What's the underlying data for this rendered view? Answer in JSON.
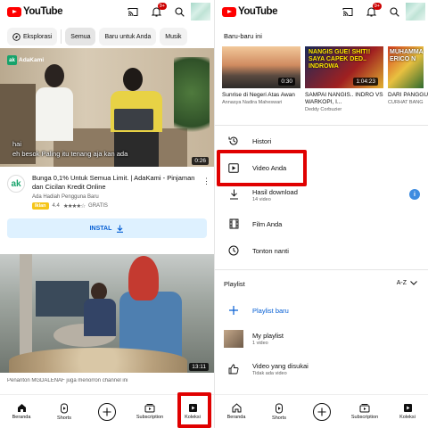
{
  "left": {
    "logo_text": "YouTube",
    "notif_count": "9+",
    "chips": [
      "Eksplorasi",
      "Semua",
      "Baru untuk Anda",
      "Musik"
    ],
    "video1": {
      "brand": "AdaKami",
      "caption_line1": "hai",
      "caption_line2": "eh besok Paling itu tenang aja kan ada",
      "duration": "0:26",
      "title": "Bunga 0,1% Untuk Semua Limit. | AdaKami - Pinjaman dan Cicilan Kredit Online",
      "sub": "Ada Hadiah Pengguna Baru",
      "ad_label": "Iklan",
      "rating": "4.4",
      "stars": "★★★★☆",
      "price": "GRATIS",
      "install_label": "INSTAL"
    },
    "video2": {
      "duration": "13:11",
      "meta": "Penanton MGDALENAF juga menorron channel ini"
    },
    "nav": [
      "Beranda",
      "Shorts",
      "",
      "Subscription",
      "Koleksi"
    ]
  },
  "right": {
    "logo_text": "YouTube",
    "notif_count": "9+",
    "recent_title": "Baru-baru ini",
    "recent": [
      {
        "title": "Sunrise di Negeri Atas Awan",
        "channel": "Annasya Nadira Maheswari",
        "duration": "0:30",
        "overlay": ""
      },
      {
        "title": "SAMPAI NANGIS.. INDRO VS WARKOPI, I...",
        "channel": "Deddy Corbuzier",
        "duration": "1:04:23",
        "overlay": "NANGIS GUE! SHIT!! SAYA CAPEK DED.. INDROWA"
      },
      {
        "title": "DARI PANGGUNG MENDUNIA...",
        "channel": "CURHAT BANG",
        "duration": "",
        "overlay": "MUHAMMA ERICO N"
      }
    ],
    "menu": [
      {
        "label": "Histori",
        "sub": ""
      },
      {
        "label": "Video Anda",
        "sub": ""
      },
      {
        "label": "Hasil download",
        "sub": "14 video"
      },
      {
        "label": "Film Anda",
        "sub": ""
      },
      {
        "label": "Tonton nanti",
        "sub": ""
      }
    ],
    "playlist_title": "Playlist",
    "sort_label": "A-Z",
    "playlists": [
      {
        "label": "Playlist baru",
        "sub": ""
      },
      {
        "label": "My playlist",
        "sub": "1 video"
      },
      {
        "label": "Video yang disukai",
        "sub": "Tidak ada video"
      }
    ],
    "nav": [
      "Beranda",
      "Shorts",
      "",
      "Subscription",
      "Koleksi"
    ]
  },
  "colors": {
    "brand_red": "#ff0000",
    "highlight_red": "#e00000",
    "link_blue": "#065fd4",
    "install_bg": "#def1ff",
    "ad_yellow": "#f5c518"
  }
}
